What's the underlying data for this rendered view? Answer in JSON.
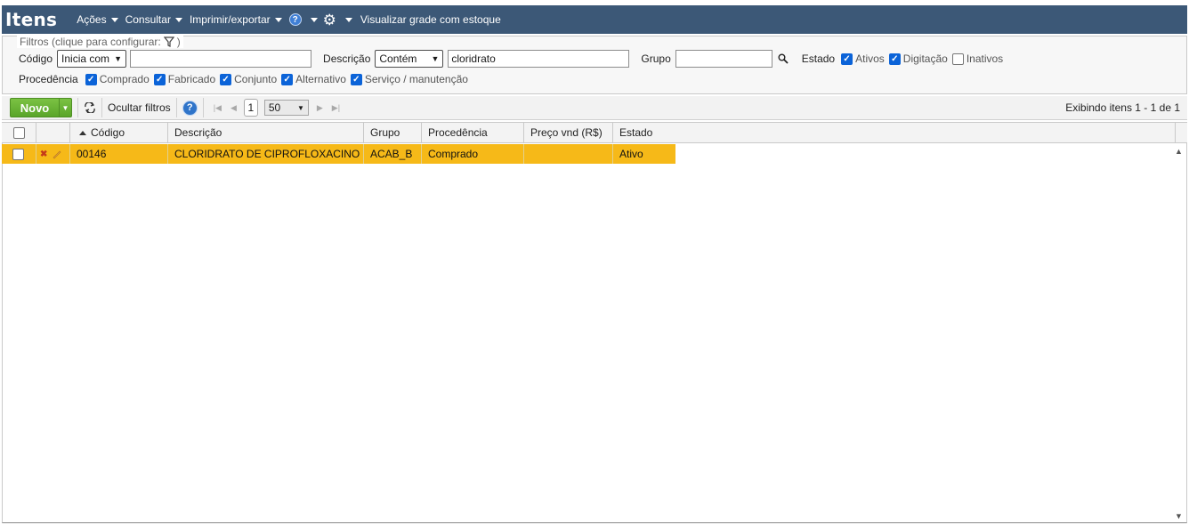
{
  "header": {
    "title": "Itens",
    "menu": [
      {
        "label": "Ações"
      },
      {
        "label": "Consultar"
      },
      {
        "label": "Imprimir/exportar"
      }
    ],
    "help_glyph": "?",
    "visualizar": "Visualizar grade com estoque"
  },
  "filters": {
    "legend": "Filtros (clique para configurar:",
    "legend_close": ")",
    "codigo_label": "Código",
    "codigo_mode": "Inicia com",
    "codigo_value": "",
    "descricao_label": "Descrição",
    "descricao_mode": "Contém",
    "descricao_value": "cloridrato",
    "grupo_label": "Grupo",
    "grupo_value": "",
    "estado_label": "Estado",
    "estado_options": [
      {
        "label": "Ativos",
        "checked": true
      },
      {
        "label": "Digitação",
        "checked": true
      },
      {
        "label": "Inativos",
        "checked": false
      }
    ],
    "procedencia_label": "Procedência",
    "procedencia_options": [
      {
        "label": "Comprado",
        "checked": true
      },
      {
        "label": "Fabricado",
        "checked": true
      },
      {
        "label": "Conjunto",
        "checked": true
      },
      {
        "label": "Alternativo",
        "checked": true
      },
      {
        "label": "Serviço / manutenção",
        "checked": true
      }
    ]
  },
  "toolbar": {
    "new_label": "Novo",
    "hide_filters": "Ocultar filtros",
    "help_glyph": "?",
    "page": "1",
    "page_size": "50",
    "showing": "Exibindo itens 1 - 1 de 1"
  },
  "grid": {
    "columns": [
      "Código",
      "Descrição",
      "Grupo",
      "Procedência",
      "Preço vnd (R$)",
      "Estado"
    ],
    "rows": [
      {
        "codigo": "00146",
        "descricao": "CLORIDRATO DE CIPROFLOXACINO ...",
        "grupo": "ACAB_B",
        "procedencia": "Comprado",
        "preco": "",
        "estado": "Ativo"
      }
    ]
  },
  "colors": {
    "header_bg": "#3c5877",
    "row_highlight": "#f6b918",
    "new_button": "#5aa52a"
  }
}
